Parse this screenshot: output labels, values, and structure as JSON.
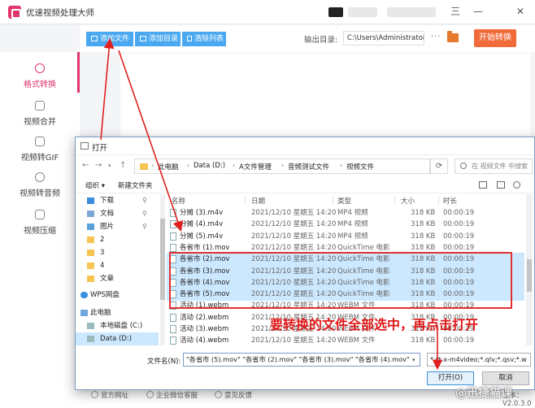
{
  "app": {
    "title": "优速视频处理大师",
    "win_controls": [
      "三",
      "—",
      "✕"
    ]
  },
  "toolbar": {
    "add_file": "添加文件",
    "add_dir": "添加目录",
    "clear_list": "清除列表",
    "output_label": "输出目录:",
    "output_path": "C:\\Users\\Administrator\\",
    "more": "···",
    "start": "开始转换"
  },
  "sidebar": {
    "items": [
      {
        "label": "格式转换",
        "active": true
      },
      {
        "label": "视频合并"
      },
      {
        "label": "视频转GIF"
      },
      {
        "label": "视频转音频"
      },
      {
        "label": "视频压缩"
      }
    ]
  },
  "bottom": {
    "links": [
      "官方网址",
      "企业微信客服",
      "意见反馈"
    ],
    "version": "版本：V2.0.3.0"
  },
  "dialog": {
    "title": "打开",
    "breadcrumb": [
      "此电脑",
      "Data (D:)",
      "A文件管理",
      "音频测试文件",
      "视频文件"
    ],
    "search_placeholder": "在 视频文件 中搜索",
    "organize": "组织 ▾",
    "new_folder": "新建文件夹",
    "nav_items": [
      {
        "label": "下载",
        "pin": true
      },
      {
        "label": "文档",
        "pin": true
      },
      {
        "label": "图片",
        "pin": true
      },
      {
        "label": "2"
      },
      {
        "label": "3"
      },
      {
        "label": "4"
      },
      {
        "label": "文章"
      },
      {
        "label": "WPS网盘"
      },
      {
        "label": "此电脑"
      },
      {
        "label": "本地磁盘 (C:)"
      },
      {
        "label": "Data (D:)",
        "selected": true
      }
    ],
    "columns": [
      "名称",
      "日期",
      "类型",
      "大小",
      "时长"
    ],
    "files": [
      {
        "name": "分摊 (3).m4v",
        "date": "2021/12/10 星期五 14:20",
        "type": "MP4 视频",
        "size": "318 KB",
        "dur": "00:00:19"
      },
      {
        "name": "分摊 (4).m4v",
        "date": "2021/12/10 星期五 14:20",
        "type": "MP4 视频",
        "size": "318 KB",
        "dur": "00:00:19"
      },
      {
        "name": "分摊 (5).m4v",
        "date": "2021/12/10 星期五 14:20",
        "type": "MP4 视频",
        "size": "318 KB",
        "dur": "00:00:19"
      },
      {
        "name": "各省市 (1).mov",
        "date": "2021/12/10 星期五 14:20",
        "type": "QuickTime 电影",
        "size": "318 KB",
        "dur": "00:00:19"
      },
      {
        "name": "各省市 (2).mov",
        "date": "2021/12/10 星期五 14:20",
        "type": "QuickTime 电影",
        "size": "318 KB",
        "dur": "00:00:19",
        "selected": true
      },
      {
        "name": "各省市 (3).mov",
        "date": "2021/12/10 星期五 14:20",
        "type": "QuickTime 电影",
        "size": "318 KB",
        "dur": "00:00:19",
        "selected": true
      },
      {
        "name": "各省市 (4).mov",
        "date": "2021/12/10 星期五 14:20",
        "type": "QuickTime 电影",
        "size": "318 KB",
        "dur": "00:00:19",
        "selected": true
      },
      {
        "name": "各省市 (5).mov",
        "date": "2021/12/10 星期五 14:20",
        "type": "QuickTime 电影",
        "size": "318 KB",
        "dur": "00:00:19",
        "selected": true
      },
      {
        "name": "活动 (1).webm",
        "date": "2021/12/10 星期五 14:20",
        "type": "WEBM 文件",
        "size": "318 KB",
        "dur": "00:00:19"
      },
      {
        "name": "活动 (2).webm",
        "date": "2021/12/10 星期五 14:20",
        "type": "WEBM 文件",
        "size": "318 KB",
        "dur": "00:00:19"
      },
      {
        "name": "活动 (3).webm",
        "date": "2021/12/10 星期五 14:20",
        "type": "WEBM 文件",
        "size": "318 KB",
        "dur": "00:00:19"
      },
      {
        "name": "活动 (4).webm",
        "date": "2021/12/10 星期五 14:20",
        "type": "WEBM 文件",
        "size": "318 KB",
        "dur": "00:00:19"
      }
    ],
    "filename_label": "文件名(N):",
    "filename_value": "\"各省市 (5).mov\" \"各省市 (2).mov\" \"各省市 (3).mov\" \"各省市 (4).mov\"",
    "filetype_value": "* (*.x-m4video;*.qlv;*.qsv;*.w",
    "open_button": "打开(O)",
    "cancel_button": "取消"
  },
  "annotation": {
    "text": "要转换的文件全部选中，再点击打开",
    "color": "#e01818"
  },
  "watermark": "@迅捷猫课"
}
